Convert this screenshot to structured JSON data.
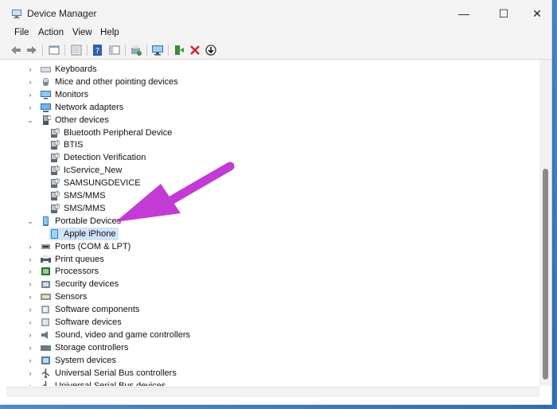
{
  "window": {
    "title": "Device Manager",
    "controls": {
      "minimize": "—",
      "maximize": "☐",
      "close": "✕"
    }
  },
  "menu": [
    "File",
    "Action",
    "View",
    "Help"
  ],
  "toolbar": [
    "back-icon",
    "forward-icon",
    "properties-window-icon",
    "show-hidden-icon",
    "help-icon",
    "console-tree-icon",
    "update-driver-icon",
    "monitor-scan-icon",
    "enable-device-icon",
    "uninstall-device-icon",
    "download-driver-icon"
  ],
  "tree": [
    {
      "label": "Keyboards",
      "level": 0,
      "expanded": false,
      "icon": "keyboard-icon"
    },
    {
      "label": "Mice and other pointing devices",
      "level": 0,
      "expanded": false,
      "icon": "mouse-icon"
    },
    {
      "label": "Monitors",
      "level": 0,
      "expanded": false,
      "icon": "monitor-icon"
    },
    {
      "label": "Network adapters",
      "level": 0,
      "expanded": false,
      "icon": "network-icon"
    },
    {
      "label": "Other devices",
      "level": 0,
      "expanded": true,
      "icon": "other-device-icon"
    },
    {
      "label": "Bluetooth Peripheral Device",
      "level": 1,
      "icon": "unknown-device-icon"
    },
    {
      "label": "BTIS",
      "level": 1,
      "icon": "unknown-device-icon"
    },
    {
      "label": "Detection Verification",
      "level": 1,
      "icon": "unknown-device-icon"
    },
    {
      "label": "IcService_New",
      "level": 1,
      "icon": "unknown-device-icon"
    },
    {
      "label": "SAMSUNGDEVICE",
      "level": 1,
      "icon": "unknown-device-icon"
    },
    {
      "label": "SMS/MMS",
      "level": 1,
      "icon": "unknown-device-icon"
    },
    {
      "label": "SMS/MMS",
      "level": 1,
      "icon": "unknown-device-icon"
    },
    {
      "label": "Portable Devices",
      "level": 0,
      "expanded": true,
      "icon": "portable-device-icon"
    },
    {
      "label": "Apple iPhone",
      "level": 1,
      "icon": "phone-icon",
      "selected": true
    },
    {
      "label": "Ports (COM & LPT)",
      "level": 0,
      "expanded": false,
      "icon": "port-icon"
    },
    {
      "label": "Print queues",
      "level": 0,
      "expanded": false,
      "icon": "printer-icon"
    },
    {
      "label": "Processors",
      "level": 0,
      "expanded": false,
      "icon": "processor-icon"
    },
    {
      "label": "Security devices",
      "level": 0,
      "expanded": false,
      "icon": "security-icon"
    },
    {
      "label": "Sensors",
      "level": 0,
      "expanded": false,
      "icon": "sensor-icon"
    },
    {
      "label": "Software components",
      "level": 0,
      "expanded": false,
      "icon": "software-component-icon"
    },
    {
      "label": "Software devices",
      "level": 0,
      "expanded": false,
      "icon": "software-device-icon"
    },
    {
      "label": "Sound, video and game controllers",
      "level": 0,
      "expanded": false,
      "icon": "sound-icon"
    },
    {
      "label": "Storage controllers",
      "level": 0,
      "expanded": false,
      "icon": "storage-icon"
    },
    {
      "label": "System devices",
      "level": 0,
      "expanded": false,
      "icon": "system-icon"
    },
    {
      "label": "Universal Serial Bus controllers",
      "level": 0,
      "expanded": false,
      "icon": "usb-icon"
    },
    {
      "label": "Universal Serial Bus devices",
      "level": 0,
      "expanded": false,
      "icon": "usb-icon"
    }
  ],
  "colors": {
    "annotation_arrow": "#c23bd4",
    "selection": "#cfe4f7"
  }
}
